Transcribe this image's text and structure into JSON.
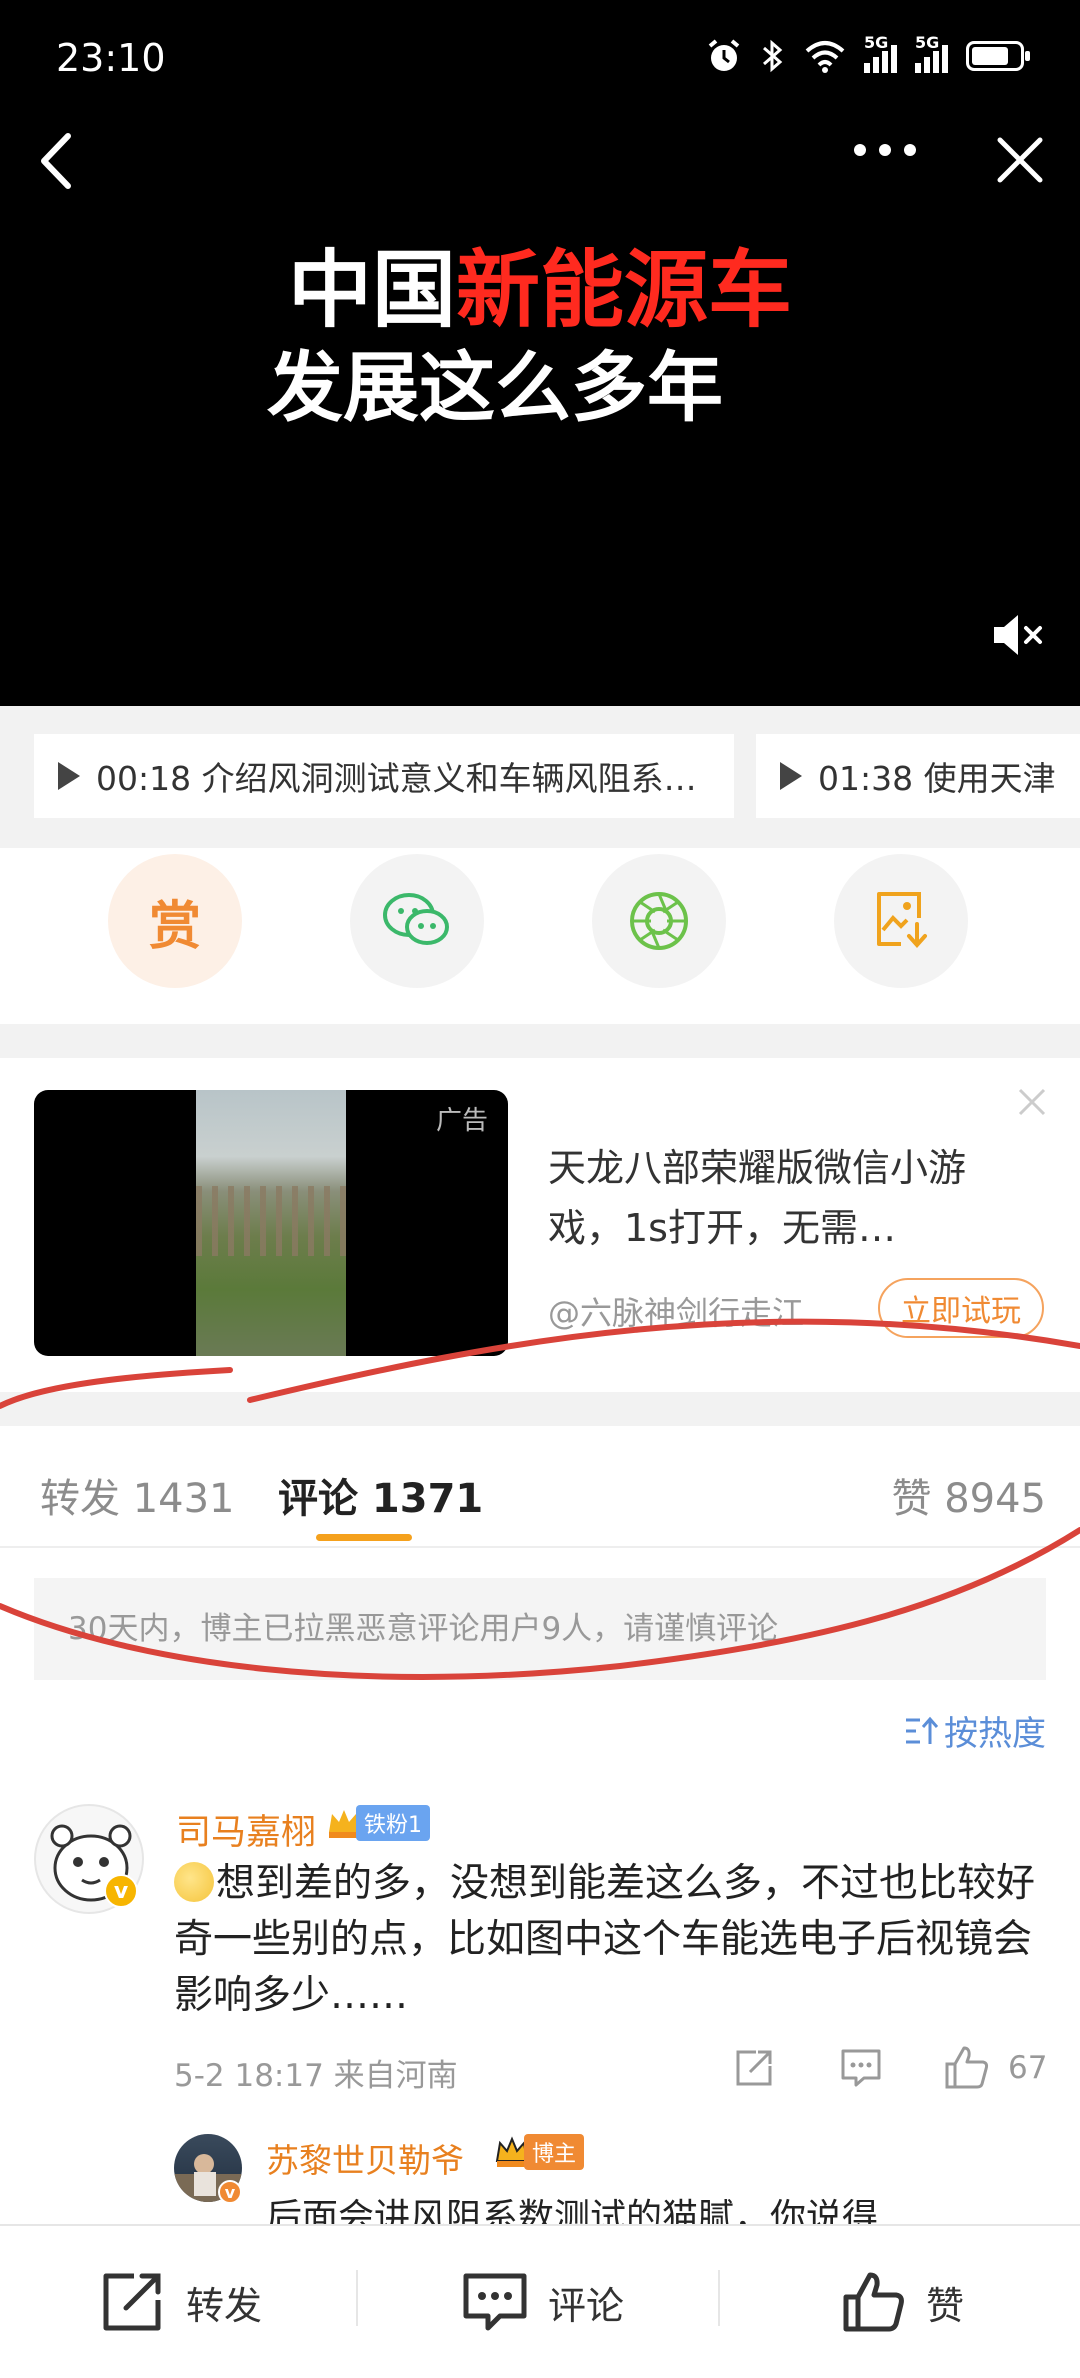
{
  "status_bar": {
    "time": "23:10",
    "net1": "5G",
    "net2": "5G"
  },
  "video": {
    "headline_white1": "中国",
    "headline_red": "新能源车",
    "headline_line2": "发展这么多年"
  },
  "chapters": [
    {
      "label": "00:18 介绍风洞测试意义和车辆风阻系…"
    },
    {
      "label": "01:38 使用天津"
    }
  ],
  "actions": [
    {
      "name": "reward",
      "label": "赏"
    },
    {
      "name": "wechat",
      "label": ""
    },
    {
      "name": "moments",
      "label": ""
    },
    {
      "name": "save-image",
      "label": ""
    }
  ],
  "ad": {
    "label": "广告",
    "title": "天龙八部荣耀版微信小游戏，1s打开，无需…",
    "source": "@六脉神剑行走江…",
    "cta": "立即试玩"
  },
  "tabs": {
    "repost": "转发 1431",
    "comment": "评论 1371",
    "like": "赞 8945"
  },
  "notice": "30天内，博主已拉黑恶意评论用户9人，请谨慎评论",
  "sort_label": "按热度",
  "comment1": {
    "username": "司马嘉栩",
    "badge": "铁粉1",
    "text": "想到差的多，没想到能差这么多，不过也比较好奇一些别的点，比如图中这个车能选电子后视镜会影响多少……",
    "meta": "5-2 18:17  来自河南",
    "likes": "67"
  },
  "comment2": {
    "username": "苏黎世贝勒爷",
    "badge": "博主",
    "text": "后面会讲风阻系数测试的猫腻，你说得"
  },
  "bottom_bar": {
    "repost": "转发",
    "comment": "评论",
    "like": "赞"
  },
  "colors": {
    "accent": "#f5a11d",
    "username": "#e8801f",
    "link": "#5b8ed8",
    "headline_red": "#ff2a1f",
    "annotation": "#d9433a"
  }
}
